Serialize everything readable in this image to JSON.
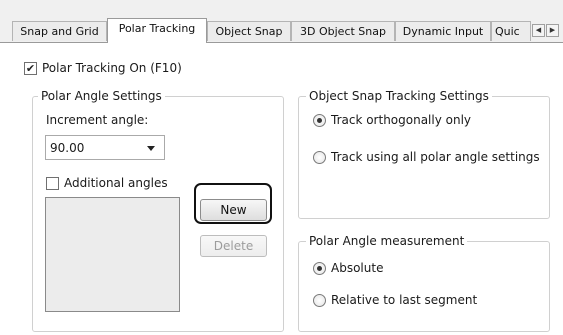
{
  "tabs": [
    {
      "label": "Snap and Grid"
    },
    {
      "label": "Polar Tracking"
    },
    {
      "label": "Object Snap"
    },
    {
      "label": "3D Object Snap"
    },
    {
      "label": "Dynamic Input"
    },
    {
      "label": "Quic"
    }
  ],
  "active_tab": "Polar Tracking",
  "polar_tracking_on": {
    "label": "Polar Tracking On (F10)",
    "checked": true
  },
  "polar_angle_settings": {
    "title": "Polar Angle Settings",
    "increment_label": "Increment angle:",
    "increment_value": "90.00",
    "additional_angles": {
      "label": "Additional angles",
      "checked": false
    },
    "new_button": "New",
    "delete_button": "Delete"
  },
  "object_snap_tracking": {
    "title": "Object Snap Tracking Settings",
    "options": [
      {
        "label": "Track orthogonally only",
        "selected": true
      },
      {
        "label": "Track using all polar angle settings",
        "selected": false
      }
    ]
  },
  "polar_angle_measurement": {
    "title": "Polar Angle measurement",
    "options": [
      {
        "label": "Absolute",
        "selected": true
      },
      {
        "label": "Relative to last segment",
        "selected": false
      }
    ]
  },
  "icons": {
    "scroll_left": "scroll-left-arrow-icon",
    "scroll_right": "scroll-right-arrow-icon",
    "checkbox_check": "checkmark-icon",
    "dropdown": "chevron-down-icon"
  }
}
